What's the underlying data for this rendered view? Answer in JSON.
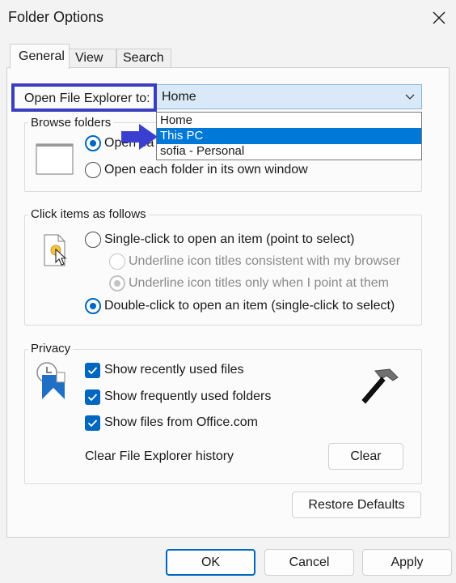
{
  "window": {
    "title": "Folder Options"
  },
  "tabs": [
    {
      "label": "General",
      "active": true
    },
    {
      "label": "View",
      "active": false
    },
    {
      "label": "Search",
      "active": false
    }
  ],
  "open_explorer": {
    "label": "Open File Explorer to:",
    "selected": "Home",
    "options": [
      "Home",
      "This PC",
      "sofia - Personal"
    ],
    "highlighted_option": "This PC"
  },
  "browse_folders": {
    "title": "Browse folders",
    "option_same": "Open each folder in the same window",
    "option_own": "Open each folder in its own window"
  },
  "click_items": {
    "title": "Click items as follows",
    "single_click": "Single-click to open an item (point to select)",
    "underline_browser": "Underline icon titles consistent with my browser",
    "underline_point": "Underline icon titles only when I point at them",
    "double_click": "Double-click to open an item (single-click to select)"
  },
  "privacy": {
    "title": "Privacy",
    "recent_files": "Show recently used files",
    "frequent_folders": "Show frequently used folders",
    "office_files": "Show files from Office.com",
    "clear_history_label": "Clear File Explorer history",
    "clear_button": "Clear"
  },
  "buttons": {
    "restore_defaults": "Restore Defaults",
    "ok": "OK",
    "cancel": "Cancel",
    "apply": "Apply"
  },
  "colors": {
    "accent": "#0067c0",
    "selection": "#0078d7",
    "highlight_box": "#3a3ec0",
    "annotation_arrow": "#3b3fd0"
  }
}
